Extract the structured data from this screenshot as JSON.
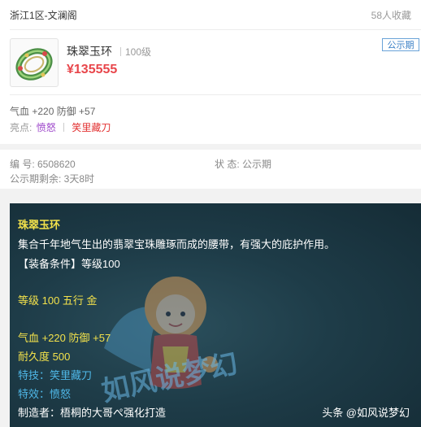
{
  "listing": {
    "server": "浙江1区-文澜阁",
    "watch_count": "58人收藏",
    "item_name": "珠翠玉环",
    "item_level": "100级",
    "price": "¥135555",
    "status_badge": "公示期",
    "stats": "气血 +220 防御 +57",
    "highlight_label": "亮点:",
    "highlight_1": "愤怒",
    "highlight_2": "笑里藏刀"
  },
  "meta": {
    "id": "编 号: 6508620",
    "state": "状 态: 公示期",
    "remaining": "公示期剩余: 3天8时"
  },
  "tooltip": {
    "title": "珠翠玉环",
    "description": "集合千年地气生出的翡翠宝珠雕琢而成的腰带，有强大的庇护作用。",
    "requirement": "【装备条件】等级100",
    "level_element": "等级 100 五行 金",
    "stats": "气血 +220 防御 +57",
    "durability": "耐久度 500",
    "skill": "特技：笑里藏刀",
    "effect": "特效：愤怒",
    "maker": "制造者：梧桐的大哥ぺ强化打造",
    "watermark_brand": "如风说梦幻",
    "credit": "头条 @如风说梦幻"
  },
  "icons": {
    "item_thumbnail": "jade-ring-icon",
    "mascot": "cartoon-mascot"
  },
  "colors": {
    "price": "#e8464b",
    "badge": "#3b80c6",
    "highlight_1": "#9b42c9",
    "highlight_2": "#e23131",
    "tooltip_yellow": "#f2e14b",
    "tooltip_blue": "#4fb8e8"
  }
}
